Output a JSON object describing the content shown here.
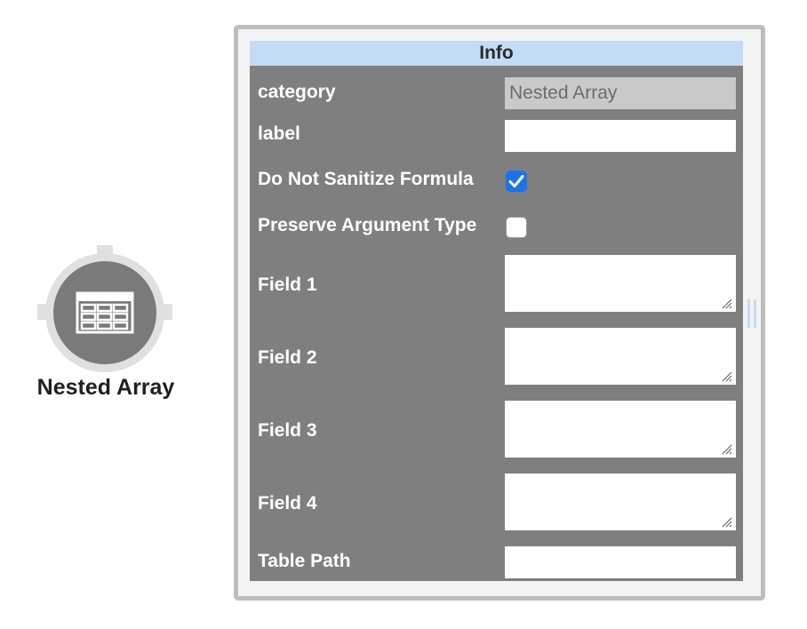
{
  "node": {
    "label": "Nested Array",
    "icon": "table-grid-icon"
  },
  "panel": {
    "header": "Info",
    "fields": {
      "category": {
        "label": "category",
        "value": "Nested Array"
      },
      "label": {
        "label": "label",
        "value": ""
      },
      "do_not_sanitize": {
        "label": "Do Not Sanitize Formula",
        "checked": true
      },
      "preserve_argument_type": {
        "label": "Preserve Argument Type",
        "checked": false
      },
      "field1": {
        "label": "Field 1",
        "value": ""
      },
      "field2": {
        "label": "Field 2",
        "value": ""
      },
      "field3": {
        "label": "Field 3",
        "value": ""
      },
      "field4": {
        "label": "Field 4",
        "value": ""
      },
      "table_path": {
        "label": "Table Path",
        "value": ""
      }
    }
  },
  "colors": {
    "panel_body": "#7f7f7f",
    "header": "#c3dcf5",
    "checkbox_checked": "#1a73e8",
    "node_core": "#7a7a7a"
  }
}
